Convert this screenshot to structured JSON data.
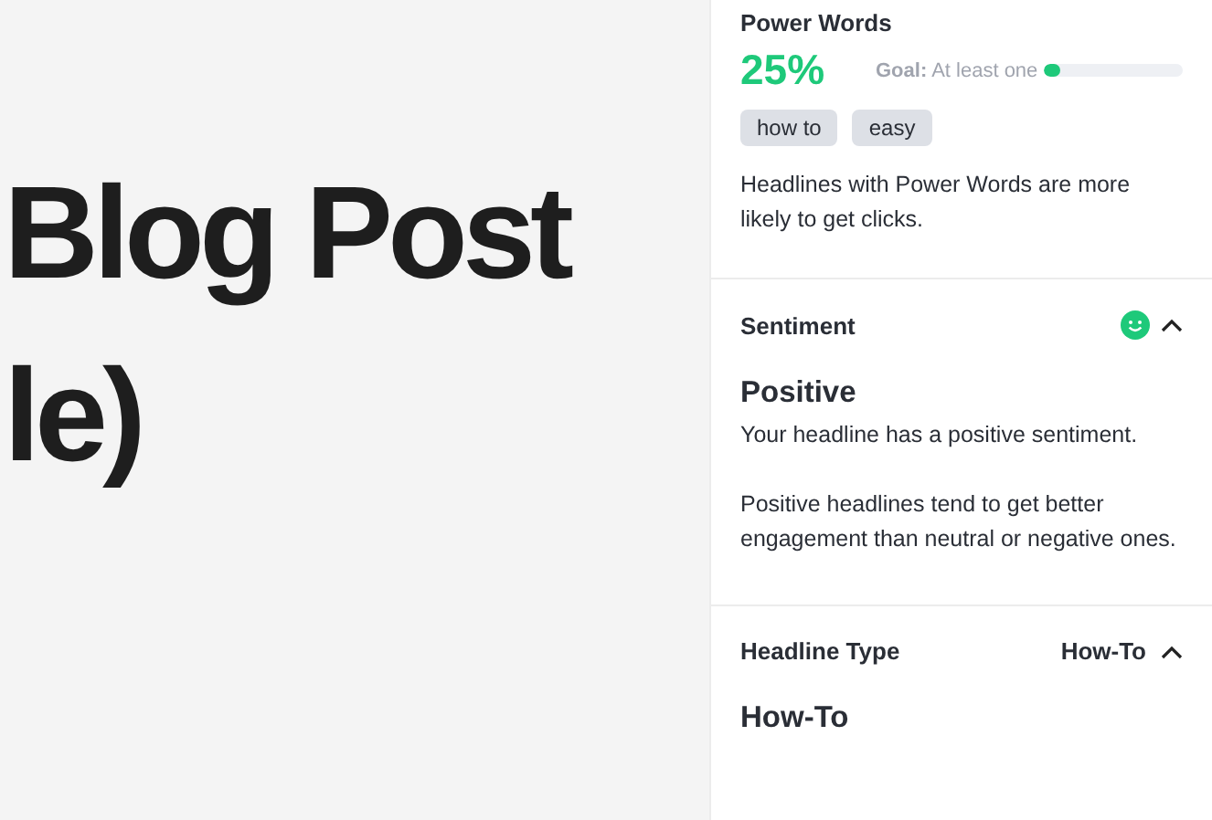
{
  "headline": {
    "lines": [
      "Blog Post",
      "le)"
    ]
  },
  "power_words": {
    "title": "Power Words",
    "score": "25%",
    "goal_label": "Goal:",
    "goal_text": "At least one",
    "level": 0.12,
    "tags": [
      "how to",
      "easy"
    ],
    "description": "Headlines with Power Words are more likely to get clicks."
  },
  "sentiment": {
    "title": "Sentiment",
    "expanded": true,
    "result": "Positive",
    "summary": "Your headline has a positive sentiment.",
    "description": "Positive headlines tend to get better engagement than neutral or negative ones."
  },
  "headline_type": {
    "title": "Headline Type",
    "value": "How-To",
    "expanded": true,
    "result": "How-To"
  }
}
